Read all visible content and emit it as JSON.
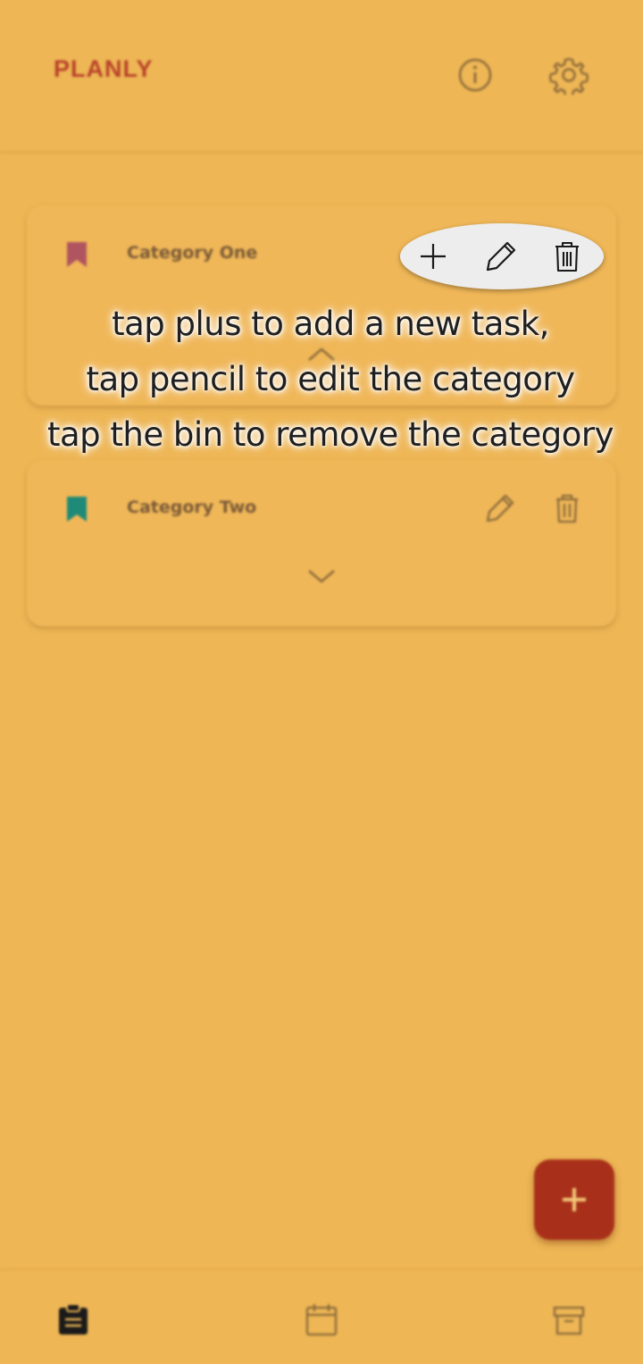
{
  "header": {
    "title": "PLANLY"
  },
  "categories": [
    {
      "name": "Category One",
      "bookmark_color": "#b0555f"
    },
    {
      "name": "Category Two",
      "bookmark_color": "#1f8a77"
    }
  ],
  "tutorial": {
    "lines": [
      "tap plus to add a new task,",
      "tap pencil to edit the category",
      "tap the bin to remove the category"
    ],
    "highlighted_icons": [
      "plus-icon",
      "pencil-icon",
      "trash-icon"
    ]
  },
  "fab": {
    "icon": "plus-icon"
  },
  "bottom_nav": {
    "items": [
      {
        "icon": "clipboard-icon",
        "active": true
      },
      {
        "icon": "calendar-icon",
        "active": false
      },
      {
        "icon": "archive-icon",
        "active": false
      }
    ]
  },
  "colors": {
    "background": "#eeb655",
    "accent": "#a8301a",
    "title": "#b8432a"
  }
}
